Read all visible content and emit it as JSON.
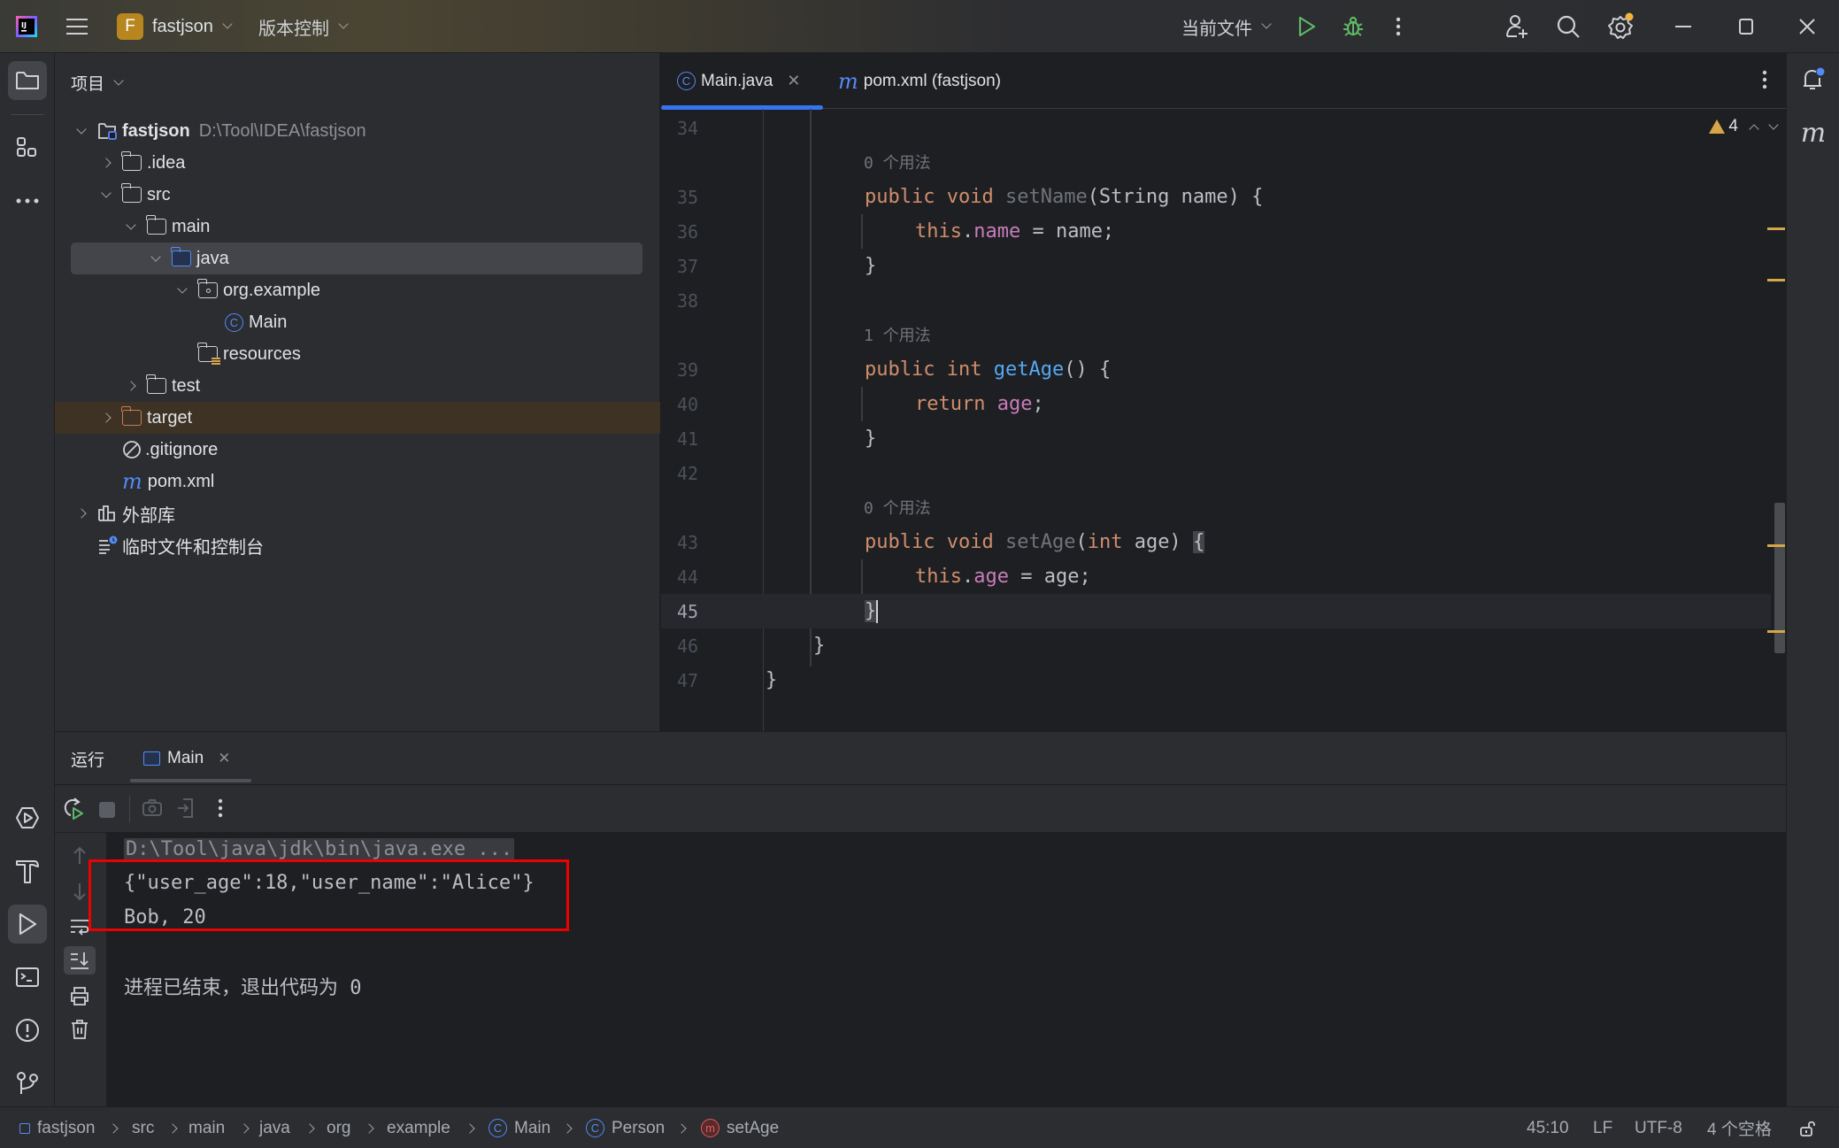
{
  "titlebar": {
    "project_badge": "F",
    "project_name": "fastjson",
    "vcs_label": "版本控制",
    "run_config": "当前文件"
  },
  "project_panel": {
    "title": "项目",
    "tree": [
      {
        "label": "fastjson",
        "hint": "D:\\Tool\\IDEA\\fastjson",
        "type": "module",
        "expanded": true,
        "depth": 0
      },
      {
        "label": ".idea",
        "type": "folder",
        "expanded": false,
        "depth": 1
      },
      {
        "label": "src",
        "type": "folder",
        "expanded": true,
        "depth": 1
      },
      {
        "label": "main",
        "type": "folder",
        "expanded": true,
        "depth": 2
      },
      {
        "label": "java",
        "type": "source-folder",
        "expanded": true,
        "depth": 3,
        "selected": true
      },
      {
        "label": "org.example",
        "type": "package",
        "expanded": true,
        "depth": 4
      },
      {
        "label": "Main",
        "type": "class",
        "depth": 5
      },
      {
        "label": "resources",
        "type": "resources-folder",
        "depth": 3
      },
      {
        "label": "test",
        "type": "folder",
        "expanded": false,
        "depth": 2
      },
      {
        "label": "target",
        "type": "excluded-folder",
        "expanded": false,
        "depth": 1
      },
      {
        "label": ".gitignore",
        "type": "ignore-file",
        "depth": 1
      },
      {
        "label": "pom.xml",
        "type": "maven-file",
        "depth": 1
      },
      {
        "label": "外部库",
        "type": "libraries",
        "expanded": false,
        "depth": 0
      },
      {
        "label": "临时文件和控制台",
        "type": "scratches",
        "depth": 0
      }
    ]
  },
  "editor": {
    "tabs": [
      {
        "label": "Main.java",
        "icon": "class-icon",
        "active": true,
        "closable": true
      },
      {
        "label": "pom.xml (fastjson)",
        "icon": "maven-icon",
        "active": false
      }
    ],
    "warnings_count": "4",
    "usage_hints": [
      "0 个用法",
      "1 个用法",
      "0 个用法"
    ],
    "lines": [
      {
        "n": "34",
        "text": ""
      },
      {
        "n": "35",
        "text": "public void setName(String name) {"
      },
      {
        "n": "36",
        "text": "this.name = name;"
      },
      {
        "n": "37",
        "text": "}"
      },
      {
        "n": "38",
        "text": ""
      },
      {
        "n": "39",
        "text": "public int getAge() {"
      },
      {
        "n": "40",
        "text": "return age;"
      },
      {
        "n": "41",
        "text": "}"
      },
      {
        "n": "42",
        "text": ""
      },
      {
        "n": "43",
        "text": "public void setAge(int age) {"
      },
      {
        "n": "44",
        "text": "this.age = age;"
      },
      {
        "n": "45",
        "text": "}"
      },
      {
        "n": "46",
        "text": "}"
      },
      {
        "n": "47",
        "text": "}"
      }
    ],
    "tokens": {
      "public": "public",
      "void": "void",
      "int": "int",
      "this": "this",
      "return": "return",
      "setName": "setName",
      "getAge": "getAge",
      "setAge": "setAge",
      "String": "String",
      "name": "name",
      "age": "age"
    },
    "current_line": "45"
  },
  "run_panel": {
    "title": "运行",
    "tab_label": "Main",
    "console": {
      "command": "D:\\Tool\\java\\jdk\\bin\\java.exe ...",
      "output": [
        "{\"user_age\":18,\"user_name\":\"Alice\"}",
        "Bob, 20"
      ],
      "exit_message": "进程已结束，退出代码为 0"
    }
  },
  "statusbar": {
    "breadcrumbs": [
      "fastjson",
      "src",
      "main",
      "java",
      "org",
      "example",
      "Main",
      "Person",
      "setAge"
    ],
    "position": "45:10",
    "line_separator": "LF",
    "encoding": "UTF-8",
    "indent": "4 个空格"
  },
  "colors": {
    "accent": "#3574f0",
    "warning": "#d5a54a",
    "run_green": "#5fb865",
    "highlight_box": "#ee0000"
  }
}
